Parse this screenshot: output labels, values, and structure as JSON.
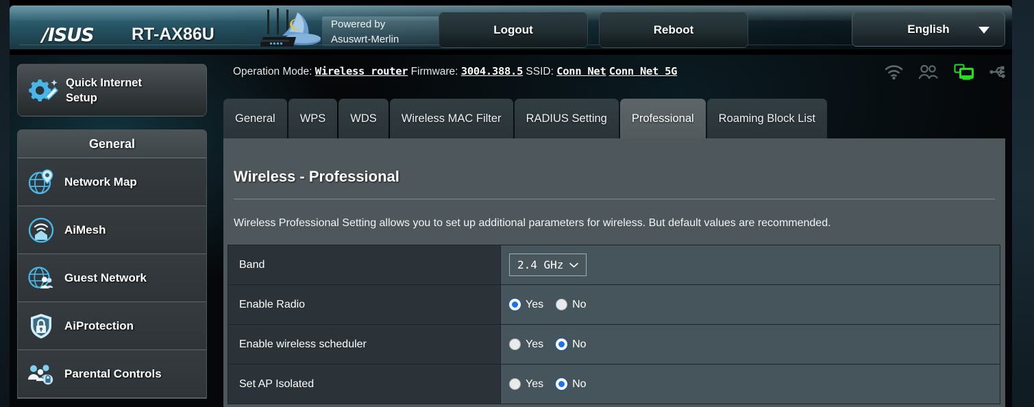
{
  "header": {
    "brand": "/ISUS",
    "model": "RT-AX86U",
    "powered_line1": "Powered by",
    "powered_line2": "Asuswrt-Merlin",
    "logout_label": "Logout",
    "reboot_label": "Reboot",
    "language": "English"
  },
  "status": {
    "operation_mode_label": "Operation Mode:",
    "operation_mode_value": "Wireless router",
    "firmware_label": "Firmware:",
    "firmware_value": "3004.388.5",
    "ssid_label": "SSID:",
    "ssid_value_1": "Conn Net",
    "ssid_value_2": "Conn Net 5G",
    "icons": [
      {
        "name": "wifi-icon",
        "state": "inactive",
        "color": "#5e696d"
      },
      {
        "name": "clients-icon",
        "state": "inactive",
        "color": "#5e696d"
      },
      {
        "name": "lan-monitor-icon",
        "state": "active",
        "color": "#23e023"
      },
      {
        "name": "usb-icon",
        "state": "inactive",
        "color": "#5e696d"
      }
    ]
  },
  "sidebar": {
    "quick_internet_setup": "Quick Internet Setup",
    "section_title": "General",
    "items": [
      {
        "label": "Network Map",
        "icon": "network-map-icon"
      },
      {
        "label": "AiMesh",
        "icon": "aimesh-icon"
      },
      {
        "label": "Guest Network",
        "icon": "guest-network-icon"
      },
      {
        "label": "AiProtection",
        "icon": "aiprotection-icon"
      },
      {
        "label": "Parental Controls",
        "icon": "parental-controls-icon"
      }
    ]
  },
  "tabs": [
    {
      "label": "General",
      "active": false
    },
    {
      "label": "WPS",
      "active": false
    },
    {
      "label": "WDS",
      "active": false
    },
    {
      "label": "Wireless MAC Filter",
      "active": false
    },
    {
      "label": "RADIUS Setting",
      "active": false
    },
    {
      "label": "Professional",
      "active": true
    },
    {
      "label": "Roaming Block List",
      "active": false
    }
  ],
  "main": {
    "title": "Wireless - Professional",
    "description": "Wireless Professional Setting allows you to set up additional parameters for wireless. But default values are recommended.",
    "rows": [
      {
        "label": "Band",
        "type": "select",
        "value": "2.4 GHz"
      },
      {
        "label": "Enable Radio",
        "type": "radio",
        "yes_label": "Yes",
        "no_label": "No",
        "selected": "Yes"
      },
      {
        "label": "Enable wireless scheduler",
        "type": "radio",
        "yes_label": "Yes",
        "no_label": "No",
        "selected": "No"
      },
      {
        "label": "Set AP Isolated",
        "type": "radio",
        "yes_label": "Yes",
        "no_label": "No",
        "selected": "No"
      }
    ]
  },
  "colors": {
    "accent_blue": "#1a73e8",
    "panel_bg": "#4e575b",
    "row_label_bg": "#2b3338",
    "row_value_bg": "#46555b",
    "active_icon_green": "#23e023",
    "sidebar_icon_blue": "#49b6e8"
  }
}
